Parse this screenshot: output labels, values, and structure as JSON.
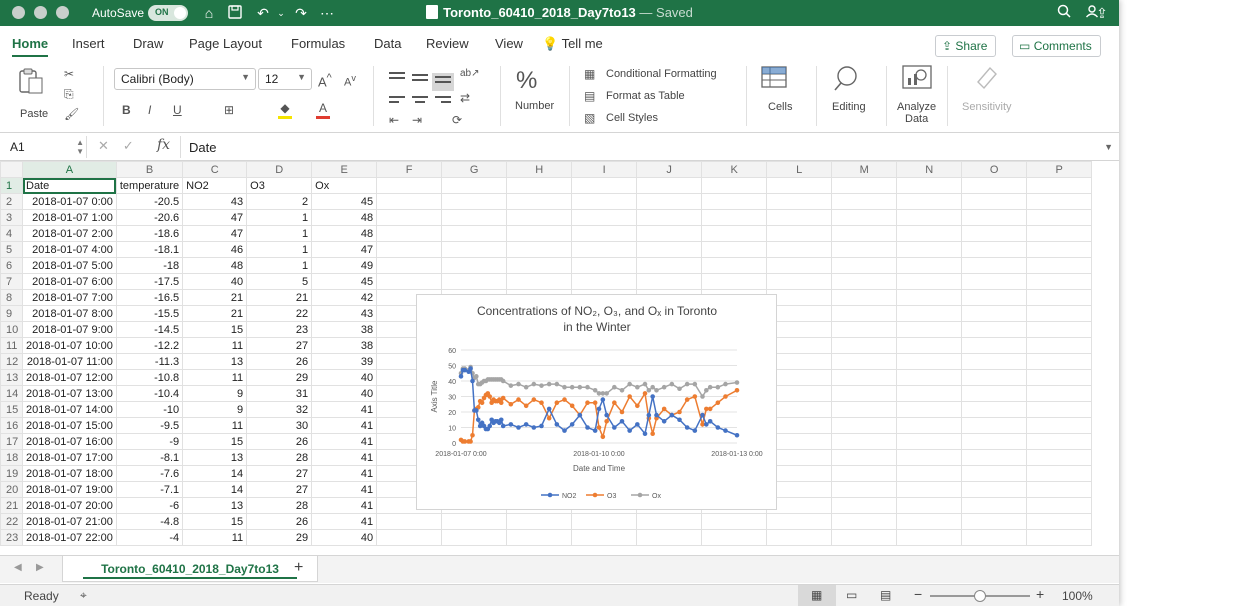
{
  "titlebar": {
    "autosave_label": "AutoSave",
    "autosave_state": "ON",
    "doc_name": "Toronto_60410_2018_Day7to13",
    "doc_status": "— Saved"
  },
  "menu": {
    "tabs": [
      "Home",
      "Insert",
      "Draw",
      "Page Layout",
      "Formulas",
      "Data",
      "Review",
      "View"
    ],
    "tell_me": "Tell me",
    "share": "Share",
    "comments": "Comments"
  },
  "ribbon": {
    "paste": "Paste",
    "font_name": "Calibri (Body)",
    "font_size": "12",
    "number": "Number",
    "cond_format": "Conditional Formatting",
    "format_table": "Format as Table",
    "cell_styles": "Cell Styles",
    "cells": "Cells",
    "editing": "Editing",
    "analyze_1": "Analyze",
    "analyze_2": "Data",
    "sensitivity": "Sensitivity"
  },
  "formula_bar": {
    "name_box": "A1",
    "content": "Date"
  },
  "columns": [
    "A",
    "B",
    "C",
    "D",
    "E",
    "F",
    "G",
    "H",
    "I",
    "J",
    "K",
    "L",
    "M",
    "N",
    "O",
    "P"
  ],
  "header_row": [
    "Date",
    "temperature",
    "NO2",
    "O3",
    "Ox"
  ],
  "rows": [
    [
      "2018-01-07 0:00",
      "-20.5",
      "43",
      "2",
      "45"
    ],
    [
      "2018-01-07 1:00",
      "-20.6",
      "47",
      "1",
      "48"
    ],
    [
      "2018-01-07 2:00",
      "-18.6",
      "47",
      "1",
      "48"
    ],
    [
      "2018-01-07 4:00",
      "-18.1",
      "46",
      "1",
      "47"
    ],
    [
      "2018-01-07 5:00",
      "-18",
      "48",
      "1",
      "49"
    ],
    [
      "2018-01-07 6:00",
      "-17.5",
      "40",
      "5",
      "45"
    ],
    [
      "2018-01-07 7:00",
      "-16.5",
      "21",
      "21",
      "42"
    ],
    [
      "2018-01-07 8:00",
      "-15.5",
      "21",
      "22",
      "43"
    ],
    [
      "2018-01-07 9:00",
      "-14.5",
      "15",
      "23",
      "38"
    ],
    [
      "2018-01-07 10:00",
      "-12.2",
      "11",
      "27",
      "38"
    ],
    [
      "2018-01-07 11:00",
      "-11.3",
      "13",
      "26",
      "39"
    ],
    [
      "2018-01-07 12:00",
      "-10.8",
      "11",
      "29",
      "40"
    ],
    [
      "2018-01-07 13:00",
      "-10.4",
      "9",
      "31",
      "40"
    ],
    [
      "2018-01-07 14:00",
      "-10",
      "9",
      "32",
      "41"
    ],
    [
      "2018-01-07 15:00",
      "-9.5",
      "11",
      "30",
      "41"
    ],
    [
      "2018-01-07 16:00",
      "-9",
      "15",
      "26",
      "41"
    ],
    [
      "2018-01-07 17:00",
      "-8.1",
      "13",
      "28",
      "41"
    ],
    [
      "2018-01-07 18:00",
      "-7.6",
      "14",
      "27",
      "41"
    ],
    [
      "2018-01-07 19:00",
      "-7.1",
      "14",
      "27",
      "41"
    ],
    [
      "2018-01-07 20:00",
      "-6",
      "13",
      "28",
      "41"
    ],
    [
      "2018-01-07 21:00",
      "-4.8",
      "15",
      "26",
      "41"
    ],
    [
      "2018-01-07 22:00",
      "-4",
      "11",
      "29",
      "40"
    ]
  ],
  "sheet_tab": "Toronto_60410_2018_Day7to13",
  "status": {
    "ready": "Ready",
    "zoom": "100%"
  },
  "chart_data": {
    "type": "line",
    "title": "Concentrations of NO₂, O₃, and Oₓ in Toronto in the Winter",
    "xlabel": "Date and Time",
    "ylabel": "Axis Title",
    "ylim": [
      0,
      60
    ],
    "yticks": [
      0,
      10,
      20,
      30,
      40,
      50,
      60
    ],
    "xticks": [
      "2018-01-07 0:00",
      "2018-01-10 0:00",
      "2018-01-13 0:00"
    ],
    "xlim": [
      0,
      144
    ],
    "legend": "bottom",
    "series": [
      {
        "name": "NO2",
        "color": "#4472c4",
        "points": [
          [
            0,
            43
          ],
          [
            1,
            47
          ],
          [
            2,
            47
          ],
          [
            4,
            46
          ],
          [
            5,
            48
          ],
          [
            6,
            40
          ],
          [
            7,
            21
          ],
          [
            8,
            21
          ],
          [
            9,
            15
          ],
          [
            10,
            11
          ],
          [
            11,
            13
          ],
          [
            12,
            11
          ],
          [
            13,
            9
          ],
          [
            14,
            9
          ],
          [
            15,
            11
          ],
          [
            16,
            15
          ],
          [
            17,
            13
          ],
          [
            18,
            14
          ],
          [
            19,
            14
          ],
          [
            20,
            13
          ],
          [
            21,
            15
          ],
          [
            22,
            11
          ],
          [
            26,
            12
          ],
          [
            30,
            10
          ],
          [
            34,
            12
          ],
          [
            38,
            10
          ],
          [
            42,
            11
          ],
          [
            46,
            22
          ],
          [
            50,
            12
          ],
          [
            54,
            8
          ],
          [
            58,
            12
          ],
          [
            62,
            18
          ],
          [
            66,
            10
          ],
          [
            70,
            8
          ],
          [
            72,
            22
          ],
          [
            74,
            28
          ],
          [
            76,
            18
          ],
          [
            80,
            10
          ],
          [
            84,
            14
          ],
          [
            88,
            8
          ],
          [
            92,
            12
          ],
          [
            96,
            6
          ],
          [
            98,
            18
          ],
          [
            100,
            30
          ],
          [
            102,
            18
          ],
          [
            106,
            14
          ],
          [
            110,
            18
          ],
          [
            114,
            15
          ],
          [
            118,
            10
          ],
          [
            122,
            8
          ],
          [
            126,
            18
          ],
          [
            128,
            12
          ],
          [
            130,
            14
          ],
          [
            134,
            10
          ],
          [
            138,
            8
          ],
          [
            144,
            5
          ]
        ]
      },
      {
        "name": "O3",
        "color": "#ed7d31",
        "points": [
          [
            0,
            2
          ],
          [
            1,
            1
          ],
          [
            2,
            1
          ],
          [
            4,
            1
          ],
          [
            5,
            1
          ],
          [
            6,
            5
          ],
          [
            7,
            21
          ],
          [
            8,
            22
          ],
          [
            9,
            23
          ],
          [
            10,
            27
          ],
          [
            11,
            26
          ],
          [
            12,
            29
          ],
          [
            13,
            31
          ],
          [
            14,
            32
          ],
          [
            15,
            30
          ],
          [
            16,
            26
          ],
          [
            17,
            28
          ],
          [
            18,
            27
          ],
          [
            19,
            27
          ],
          [
            20,
            28
          ],
          [
            21,
            26
          ],
          [
            22,
            29
          ],
          [
            26,
            25
          ],
          [
            30,
            28
          ],
          [
            34,
            24
          ],
          [
            38,
            28
          ],
          [
            42,
            26
          ],
          [
            46,
            16
          ],
          [
            50,
            26
          ],
          [
            54,
            28
          ],
          [
            58,
            24
          ],
          [
            62,
            18
          ],
          [
            66,
            26
          ],
          [
            70,
            26
          ],
          [
            72,
            10
          ],
          [
            74,
            4
          ],
          [
            76,
            14
          ],
          [
            80,
            26
          ],
          [
            84,
            20
          ],
          [
            88,
            30
          ],
          [
            92,
            24
          ],
          [
            96,
            32
          ],
          [
            98,
            16
          ],
          [
            100,
            6
          ],
          [
            102,
            16
          ],
          [
            106,
            22
          ],
          [
            110,
            18
          ],
          [
            114,
            20
          ],
          [
            118,
            28
          ],
          [
            122,
            30
          ],
          [
            126,
            12
          ],
          [
            128,
            22
          ],
          [
            130,
            22
          ],
          [
            134,
            26
          ],
          [
            138,
            30
          ],
          [
            144,
            34
          ]
        ]
      },
      {
        "name": "Ox",
        "color": "#a5a5a5",
        "points": [
          [
            0,
            45
          ],
          [
            1,
            48
          ],
          [
            2,
            48
          ],
          [
            4,
            47
          ],
          [
            5,
            49
          ],
          [
            6,
            45
          ],
          [
            7,
            42
          ],
          [
            8,
            43
          ],
          [
            9,
            38
          ],
          [
            10,
            38
          ],
          [
            11,
            39
          ],
          [
            12,
            40
          ],
          [
            13,
            40
          ],
          [
            14,
            41
          ],
          [
            15,
            41
          ],
          [
            16,
            41
          ],
          [
            17,
            41
          ],
          [
            18,
            41
          ],
          [
            19,
            41
          ],
          [
            20,
            41
          ],
          [
            21,
            41
          ],
          [
            22,
            40
          ],
          [
            26,
            37
          ],
          [
            30,
            38
          ],
          [
            34,
            36
          ],
          [
            38,
            38
          ],
          [
            42,
            37
          ],
          [
            46,
            38
          ],
          [
            50,
            38
          ],
          [
            54,
            36
          ],
          [
            58,
            36
          ],
          [
            62,
            36
          ],
          [
            66,
            36
          ],
          [
            70,
            34
          ],
          [
            72,
            32
          ],
          [
            74,
            32
          ],
          [
            76,
            32
          ],
          [
            80,
            36
          ],
          [
            84,
            34
          ],
          [
            88,
            38
          ],
          [
            92,
            36
          ],
          [
            96,
            38
          ],
          [
            98,
            34
          ],
          [
            100,
            36
          ],
          [
            102,
            34
          ],
          [
            106,
            36
          ],
          [
            110,
            38
          ],
          [
            114,
            35
          ],
          [
            118,
            38
          ],
          [
            122,
            38
          ],
          [
            126,
            30
          ],
          [
            128,
            34
          ],
          [
            130,
            36
          ],
          [
            134,
            36
          ],
          [
            138,
            38
          ],
          [
            144,
            39
          ]
        ]
      }
    ]
  }
}
